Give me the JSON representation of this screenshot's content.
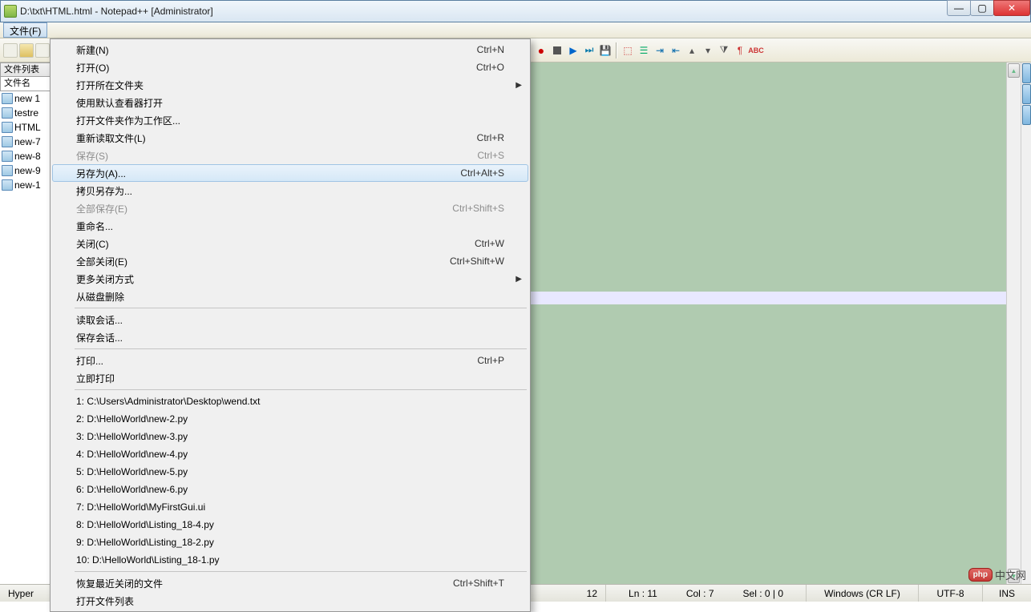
{
  "title": "D:\\txt\\HTML.html - Notepad++ [Administrator]",
  "menubar": {
    "file": "文件(F)"
  },
  "tab_close_x": "×",
  "file_panel": {
    "header": "文件列表",
    "col_name": "文件名"
  },
  "files": [
    {
      "name": "new 1"
    },
    {
      "name": "testre"
    },
    {
      "name": "HTML"
    },
    {
      "name": "new-7"
    },
    {
      "name": "new-8"
    },
    {
      "name": "new-9"
    },
    {
      "name": "new-1"
    }
  ],
  "menu": {
    "new": {
      "label": "新建(N)",
      "shortcut": "Ctrl+N"
    },
    "open": {
      "label": "打开(O)",
      "shortcut": "Ctrl+O"
    },
    "open_folder": {
      "label": "打开所在文件夹"
    },
    "open_default": {
      "label": "使用默认查看器打开"
    },
    "open_workspace": {
      "label": "打开文件夹作为工作区..."
    },
    "reload": {
      "label": "重新读取文件(L)",
      "shortcut": "Ctrl+R"
    },
    "save": {
      "label": "保存(S)",
      "shortcut": "Ctrl+S"
    },
    "save_as": {
      "label": "另存为(A)...",
      "shortcut": "Ctrl+Alt+S"
    },
    "save_copy": {
      "label": "拷贝另存为..."
    },
    "save_all": {
      "label": "全部保存(E)",
      "shortcut": "Ctrl+Shift+S"
    },
    "rename": {
      "label": "重命名..."
    },
    "close": {
      "label": "关闭(C)",
      "shortcut": "Ctrl+W"
    },
    "close_all": {
      "label": "全部关闭(E)",
      "shortcut": "Ctrl+Shift+W"
    },
    "close_more": {
      "label": "更多关闭方式"
    },
    "delete_disk": {
      "label": "从磁盘删除"
    },
    "read_session": {
      "label": "读取会话..."
    },
    "save_session": {
      "label": "保存会话..."
    },
    "print": {
      "label": "打印...",
      "shortcut": "Ctrl+P"
    },
    "print_now": {
      "label": "立即打印"
    },
    "recent": [
      "1: C:\\Users\\Administrator\\Desktop\\wend.txt",
      "2: D:\\HelloWorld\\new-2.py",
      "3: D:\\HelloWorld\\new-3.py",
      "4: D:\\HelloWorld\\new-4.py",
      "5: D:\\HelloWorld\\new-5.py",
      "6: D:\\HelloWorld\\new-6.py",
      "7: D:\\HelloWorld\\MyFirstGui.ui",
      "8: D:\\HelloWorld\\Listing_18-4.py",
      "9: D:\\HelloWorld\\Listing_18-2.py",
      "10: D:\\HelloWorld\\Listing_18-1.py"
    ],
    "restore_recent": {
      "label": "恢复最近关闭的文件",
      "shortcut": "Ctrl+Shift+T"
    },
    "open_filelist": {
      "label": "打开文件列表"
    }
  },
  "status": {
    "lang": "Hyper Te",
    "len_12": "12",
    "ln": "Ln : 11",
    "col": "Col : 7",
    "sel": "Sel : 0 | 0",
    "eol": "Windows (CR LF)",
    "enc": "UTF-8",
    "mode": "INS"
  },
  "watermark": {
    "badge": "php",
    "text": "中文网"
  }
}
